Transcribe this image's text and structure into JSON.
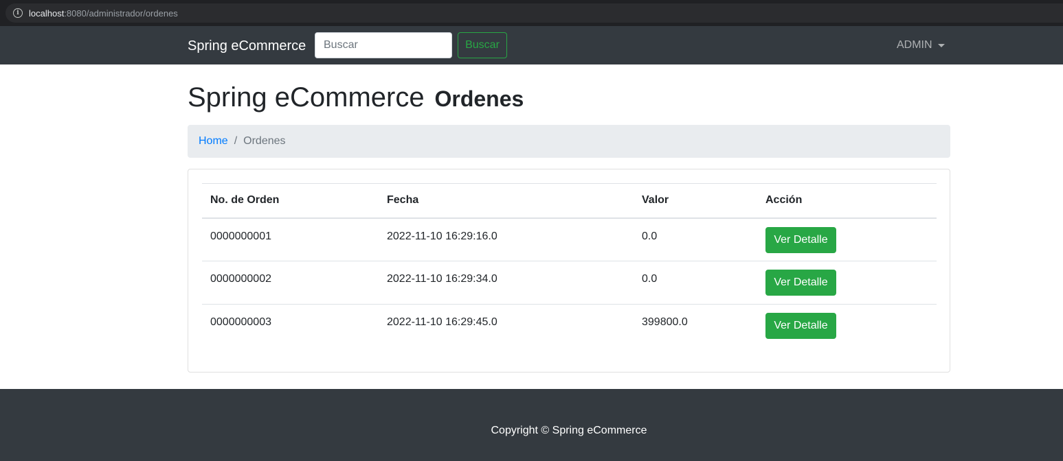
{
  "browser": {
    "url_host": "localhost",
    "url_rest": ":8080/administrador/ordenes"
  },
  "navbar": {
    "brand": "Spring eCommerce",
    "search_placeholder": "Buscar",
    "search_button": "Buscar",
    "user_menu": "ADMIN"
  },
  "page": {
    "title": "Spring eCommerce",
    "subtitle": "Ordenes"
  },
  "breadcrumb": {
    "home": "Home",
    "separator": "/",
    "current": "Ordenes"
  },
  "table": {
    "headers": [
      "No. de Orden",
      "Fecha",
      "Valor",
      "Acción"
    ],
    "rows": [
      {
        "order": "0000000001",
        "date": "2022-11-10 16:29:16.0",
        "value": "0.0",
        "action": "Ver Detalle"
      },
      {
        "order": "0000000002",
        "date": "2022-11-10 16:29:34.0",
        "value": "0.0",
        "action": "Ver Detalle"
      },
      {
        "order": "0000000003",
        "date": "2022-11-10 16:29:45.0",
        "value": "399800.0",
        "action": "Ver Detalle"
      }
    ]
  },
  "footer": {
    "copyright": "Copyright © Spring eCommerce"
  },
  "colors": {
    "navbar_bg": "#343a40",
    "success": "#28a745",
    "link": "#007bff",
    "breadcrumb_bg": "#e9ecef"
  }
}
